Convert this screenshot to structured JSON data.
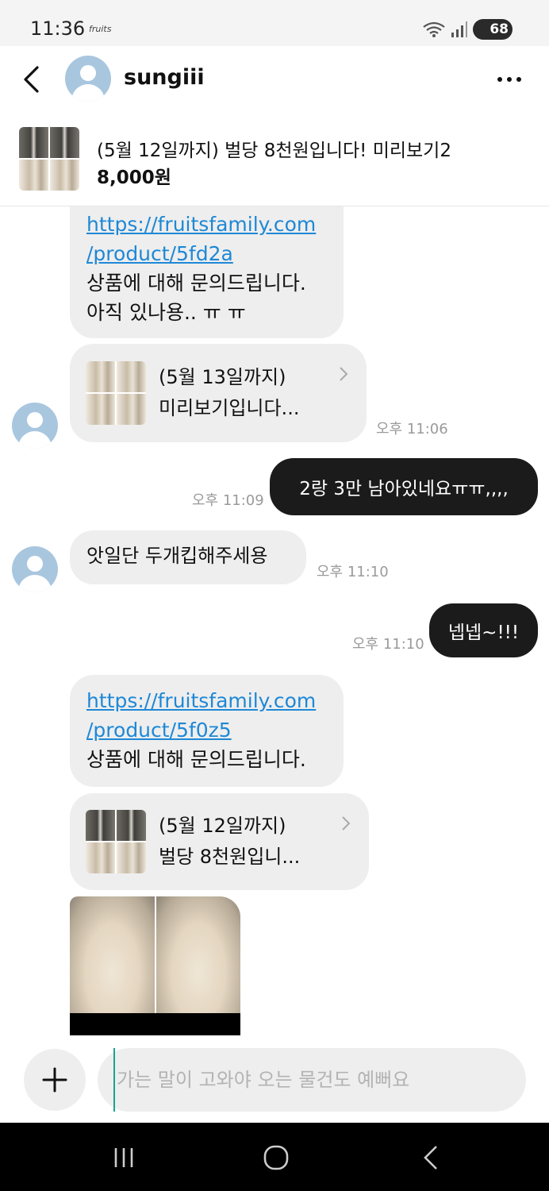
{
  "status_bar": {
    "time": "11:36",
    "app_label": "fruits",
    "battery": "68"
  },
  "header": {
    "username": "sungiii"
  },
  "product": {
    "title": "(5월 12일까지) 벌당 8천원입니다! 미리보기2",
    "price": "8,000원"
  },
  "messages": {
    "m1": {
      "link_line1": "https://fruitsfamily.com",
      "link_line2": "/product/5fd2a",
      "text_line1": "상품에 대해 문의드립니다.",
      "text_line2": "아직 있나용.. ㅠ ㅠ"
    },
    "card1": {
      "line1": "(5월 13일까지)",
      "line2": "미리보기입니다...",
      "time": "오후 11:06"
    },
    "m2": {
      "text": "2랑 3만 남아있네요ㅠㅠ,,,,",
      "time": "오후 11:09"
    },
    "m3": {
      "text": "앗일단 두개킵해주세용",
      "time": "오후 11:10"
    },
    "m4": {
      "text": "넵넵~!!!",
      "time": "오후 11:10"
    },
    "m5": {
      "link_line1": "https://fruitsfamily.com",
      "link_line2": "/product/5f0z5",
      "text_line1": "상품에 대해 문의드립니다."
    },
    "card2": {
      "line1": "(5월 12일까지)",
      "line2": "벌당 8천원입니..."
    }
  },
  "input": {
    "placeholder": "가는 말이 고와야 오는 물건도 예뻐요"
  },
  "icons": {
    "back": "chevron-left-icon",
    "more": "more-dots-icon",
    "plus": "plus-icon",
    "nav_recents": "recents-icon",
    "nav_home": "home-icon",
    "nav_back": "back-icon"
  },
  "colors": {
    "link": "#1e88d6",
    "outgoing_bubble": "#1b1b1b",
    "incoming_bubble": "#eeeeee",
    "cursor": "#18a58e"
  }
}
